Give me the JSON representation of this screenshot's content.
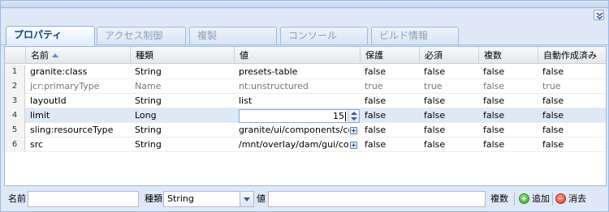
{
  "tabs": [
    {
      "label": "プロパティ",
      "active": true
    },
    {
      "label": "アクセス制御",
      "active": false
    },
    {
      "label": "複製",
      "active": false
    },
    {
      "label": "コンソール",
      "active": false
    },
    {
      "label": "ビルド情報",
      "active": false
    }
  ],
  "grid": {
    "columns": [
      "名前",
      "種類",
      "値",
      "保護",
      "必須",
      "複数",
      "自動作成済み"
    ],
    "sort": {
      "column": "名前",
      "direction": "ascending"
    },
    "rows": [
      {
        "num": "1",
        "name": "granite:class",
        "type": "String",
        "value": "presets-table",
        "protected": "false",
        "mandatory": "false",
        "multiple": "false",
        "autocreated": "false"
      },
      {
        "num": "2",
        "name": "jcr:primaryType",
        "type": "Name",
        "value": "nt:unstructured",
        "protected": "true",
        "mandatory": "true",
        "multiple": "false",
        "autocreated": "true"
      },
      {
        "num": "3",
        "name": "layoutId",
        "type": "String",
        "value": "list",
        "protected": "false",
        "mandatory": "false",
        "multiple": "false",
        "autocreated": "false"
      },
      {
        "num": "4",
        "name": "limit",
        "type": "Long",
        "value": "15",
        "protected": "false",
        "mandatory": "false",
        "multiple": "false",
        "autocreated": "false"
      },
      {
        "num": "5",
        "name": "sling:resourceType",
        "type": "String",
        "value": "granite/ui/components/coral/...",
        "protected": "false",
        "mandatory": "false",
        "multiple": "false",
        "autocreated": "false"
      },
      {
        "num": "6",
        "name": "src",
        "type": "String",
        "value": "/mnt/overlay/dam/gui/coral/c...",
        "protected": "false",
        "mandatory": "false",
        "multiple": "false",
        "autocreated": "false"
      }
    ]
  },
  "bottom": {
    "name_label": "名前",
    "name_value": "",
    "type_label": "種類",
    "type_value": "String",
    "value_label": "値",
    "value_value": "",
    "multi_label": "複数",
    "add_label": "追加",
    "delete_label": "消去"
  }
}
